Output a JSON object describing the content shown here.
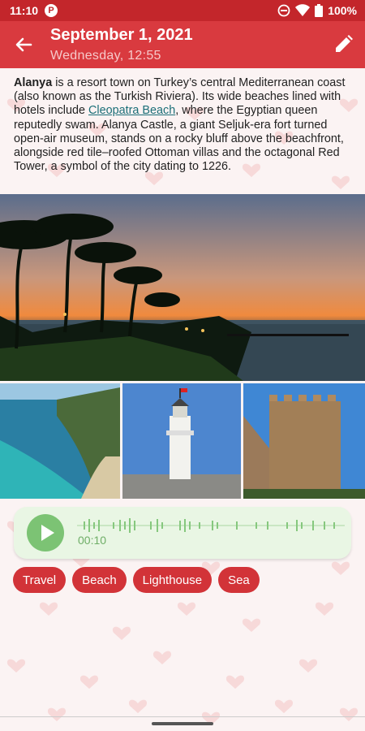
{
  "status_bar": {
    "time": "11:10",
    "app_badge": "P",
    "battery": "100%",
    "icons": [
      "do-not-disturb-icon",
      "wifi-icon",
      "battery-icon"
    ]
  },
  "app_bar": {
    "title": "September 1, 2021",
    "subtitle": "Wednesday, 12:55",
    "back_icon": "back-arrow-icon",
    "edit_icon": "pencil-icon"
  },
  "entry": {
    "bold_word": "Alanya",
    "text_before_link": " is a resort town on Turkey’s central Mediterranean coast (also known as the Turkish Riviera). Its wide beaches lined with hotels include ",
    "link_text": "Cleopatra Beach",
    "text_after_link": ", where the Egyptian queen reputedly swam. Alanya Castle, a giant Seljuk-era fort turned open-air museum, stands on a rocky bluff above the beachfront, alongside red tile–roofed Ottoman villas and the octagonal Red Tower, a symbol of the city dating to 1226."
  },
  "photos": [
    {
      "name": "sunset-palms-photo"
    },
    {
      "name": "coastline-photo"
    },
    {
      "name": "lighthouse-photo"
    },
    {
      "name": "red-tower-photo"
    }
  ],
  "audio": {
    "time": "00:10",
    "play_icon": "play-icon"
  },
  "tags": [
    "Travel",
    "Beach",
    "Lighthouse",
    "Sea"
  ],
  "colors": {
    "primary": "#d93a3f",
    "status_bar": "#c3262b",
    "tag": "#d23338",
    "audio_card": "#e9f6e4",
    "audio_accent": "#7cc374",
    "link": "#1b6f78"
  }
}
